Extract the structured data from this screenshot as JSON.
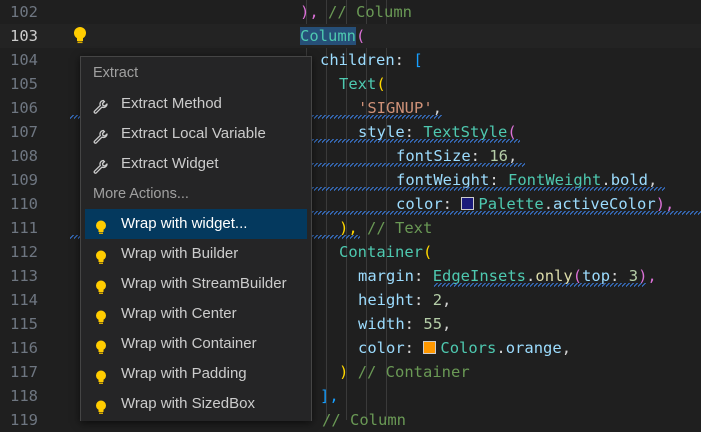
{
  "editor": {
    "lines": [
      {
        "n": "102",
        "current": false
      },
      {
        "n": "103",
        "current": true
      },
      {
        "n": "104",
        "current": false
      },
      {
        "n": "105",
        "current": false
      },
      {
        "n": "106",
        "current": false
      },
      {
        "n": "107",
        "current": false
      },
      {
        "n": "108",
        "current": false
      },
      {
        "n": "109",
        "current": false
      },
      {
        "n": "110",
        "current": false
      },
      {
        "n": "111",
        "current": false
      },
      {
        "n": "112",
        "current": false
      },
      {
        "n": "113",
        "current": false
      },
      {
        "n": "114",
        "current": false
      },
      {
        "n": "115",
        "current": false
      },
      {
        "n": "116",
        "current": false
      },
      {
        "n": "117",
        "current": false
      },
      {
        "n": "118",
        "current": false
      },
      {
        "n": "119",
        "current": false
      }
    ],
    "code": {
      "l102_close": "),",
      "l102_comment": "// Column",
      "l103_class": "Column",
      "l103_paren": "(",
      "l104_prop": "children",
      "l104_colon": ":",
      "l104_bracket": "[",
      "l105_class": "Text",
      "l105_paren": "(",
      "l106_str": "'SIGNUP'",
      "l106_comma": ",",
      "l107_prop": "style",
      "l107_colon": ":",
      "l107_class": "TextStyle",
      "l107_paren": "(",
      "l108_prop": "fontSize",
      "l108_colon": ":",
      "l108_num": "16",
      "l108_comma": ",",
      "l109_prop": "fontWeight",
      "l109_colon": ":",
      "l109_class": "FontWeight",
      "l109_dot": ".",
      "l109_member": "bold",
      "l109_comma": ",",
      "l110_prop": "color",
      "l110_colon": ":",
      "l110_class": "Palette",
      "l110_dot": ".",
      "l110_member": "activeColor",
      "l110_close": "),",
      "l111_close": "),",
      "l111_comment": "// Text",
      "l112_class": "Container",
      "l112_paren": "(",
      "l113_prop": "margin",
      "l113_colon": ":",
      "l113_class": "EdgeInsets",
      "l113_dot": ".",
      "l113_method": "only",
      "l113_paren": "(",
      "l113_arg": "top",
      "l113_colon2": ":",
      "l113_num": "3",
      "l113_close": "),",
      "l114_prop": "height",
      "l114_colon": ":",
      "l114_num": "2",
      "l114_comma": ",",
      "l115_prop": "width",
      "l115_colon": ":",
      "l115_num": "55",
      "l115_comma": ",",
      "l116_prop": "color",
      "l116_colon": ":",
      "l116_class": "Colors",
      "l116_dot": ".",
      "l116_member": "orange",
      "l116_comma": ",",
      "l117_close": ")",
      "l117_comment": "// Container",
      "l118_close": "],",
      "l119_comment": "// Column"
    },
    "swatches": {
      "palette_active": "#1a1a7a",
      "orange": "#ff9800"
    }
  },
  "menu": {
    "section_extract": "Extract",
    "section_more": "More Actions...",
    "items": [
      {
        "label": "Extract Method",
        "icon": "wrench-icon"
      },
      {
        "label": "Extract Local Variable",
        "icon": "wrench-icon"
      },
      {
        "label": "Extract Widget",
        "icon": "wrench-icon"
      },
      {
        "label": "Wrap with widget...",
        "icon": "lightbulb-icon",
        "selected": true
      },
      {
        "label": "Wrap with Builder",
        "icon": "lightbulb-icon"
      },
      {
        "label": "Wrap with StreamBuilder",
        "icon": "lightbulb-icon"
      },
      {
        "label": "Wrap with Center",
        "icon": "lightbulb-icon"
      },
      {
        "label": "Wrap with Container",
        "icon": "lightbulb-icon"
      },
      {
        "label": "Wrap with Padding",
        "icon": "lightbulb-icon"
      },
      {
        "label": "Wrap with SizedBox",
        "icon": "lightbulb-icon"
      }
    ]
  },
  "colors": {
    "selection": "#04395e",
    "bulb": "#ffcc00"
  }
}
